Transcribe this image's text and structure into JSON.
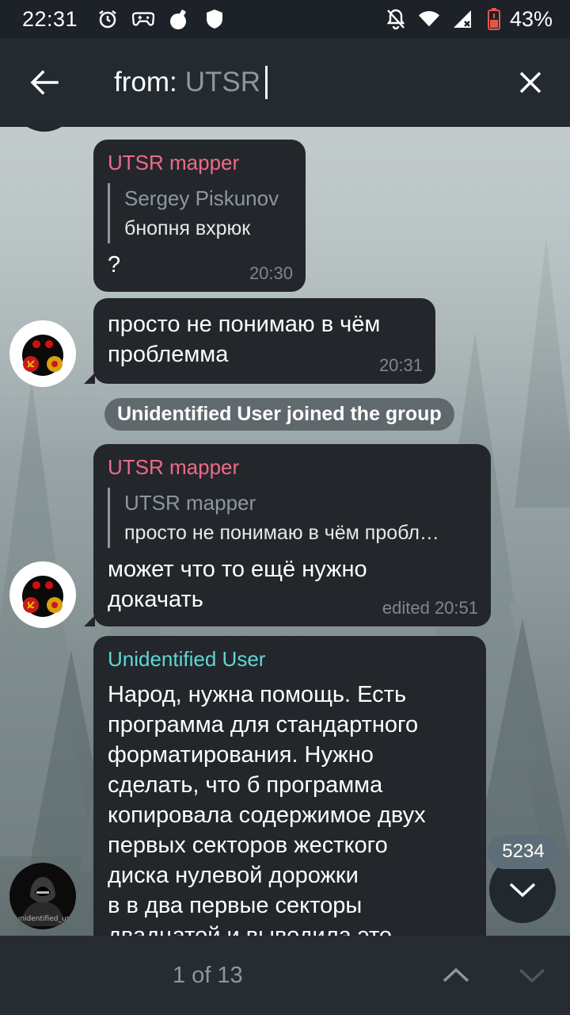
{
  "status_bar": {
    "time": "22:31",
    "battery": "43%",
    "left_icons": [
      "alarm-icon",
      "gamepad-icon",
      "bomb-icon",
      "shield-icon"
    ],
    "right_icons": [
      "bell-off-icon",
      "wifi-icon",
      "signal-icon",
      "battery-icon"
    ]
  },
  "search": {
    "prefix": "from:",
    "value": "UTSR"
  },
  "messages": [
    {
      "sender": "UTSR mapper",
      "reply_name": "Sergey Piskunov",
      "reply_text": "бнопня вхрюк",
      "text": "?",
      "time": "20:30"
    },
    {
      "text": "просто не понимаю в чём\nпроблемма",
      "time": "20:31"
    },
    {
      "service": "Unidentified User joined the group"
    },
    {
      "sender": "UTSR mapper",
      "reply_name": "UTSR mapper",
      "reply_text": "просто не понимаю в чём пробл…",
      "text": "может что то ещё нужно\nдокачать",
      "time": "edited 20:51"
    },
    {
      "sender": "Unidentified User",
      "text": "Народ, нужна помощь. Есть\nпрограмма для стандартного\nформатирования. Нужно\nсделать, что б программа\nкопировала содержимое двух\nпервых секторов жесткого\nдиска нулевой дорожки\nв в два первые секторы\nдвадцатой и выводила это"
    }
  ],
  "avatars": {
    "utsr_mapper": "utsr-avatar",
    "unidentified_user_label": "unidentified_us"
  },
  "colors": {
    "utsr_mapper_name": "#ef6a8a",
    "unidentified_user_name": "#5fd6d6",
    "bubble": "#23272b",
    "topbar": "#232a30"
  },
  "unread_count": "5234",
  "bottom": {
    "counter": "1 of 13"
  }
}
